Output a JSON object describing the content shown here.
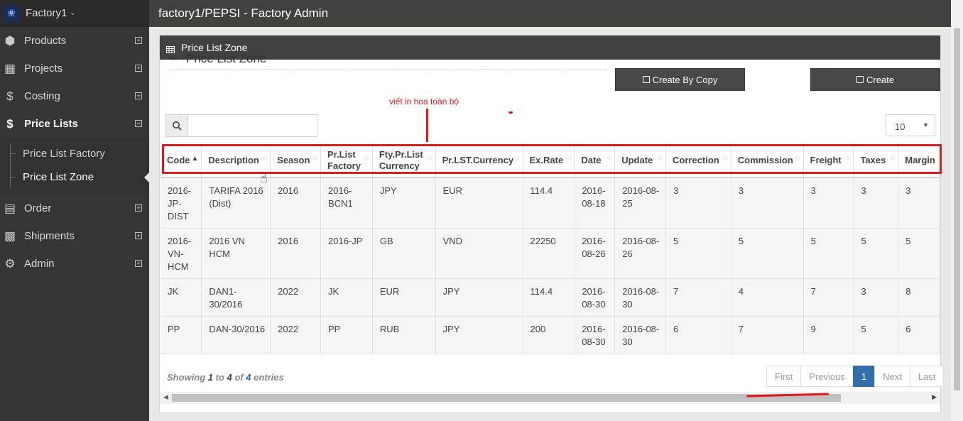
{
  "brand": {
    "name": "Factory1"
  },
  "header": {
    "title": "factory1/PEPSI - Factory Admin"
  },
  "sidebar": {
    "items": [
      {
        "label": "Products"
      },
      {
        "label": "Projects"
      },
      {
        "label": "Costing"
      },
      {
        "label": "Price Lists"
      },
      {
        "label": "Order"
      },
      {
        "label": "Shipments"
      },
      {
        "label": "Admin"
      }
    ],
    "submenu": [
      {
        "label": "Price List Factory"
      },
      {
        "label": "Price List Zone"
      }
    ]
  },
  "panel": {
    "heading": "Price List Zone",
    "subtitle": "Price List Zone",
    "create_by_copy_label": "Create By Copy",
    "create_label": "Create",
    "annotation": "viết in hoa toàn bộ",
    "page_length": "10"
  },
  "table": {
    "columns": [
      "Code",
      "Description",
      "Season",
      "Pr.List Factory",
      "Fty.Pr.List Currency",
      "Pr.LST.Currency",
      "Ex.Rate",
      "Date",
      "Update",
      "Correction",
      "Commission",
      "Freight",
      "Taxes",
      "Margin"
    ],
    "rows": [
      [
        "2016-JP-DIST",
        "TARIFA 2016 (Dist)",
        "2016",
        "2016-BCN1",
        "JPY",
        "EUR",
        "114.4",
        "2016-08-18",
        "2016-08-25",
        "3",
        "3",
        "3",
        "3",
        "3"
      ],
      [
        "2016-VN-HCM",
        "2016 VN HCM",
        "2016",
        "2016-JP",
        "GB",
        "VND",
        "22250",
        "2016-08-26",
        "2016-08-26",
        "5",
        "5",
        "5",
        "5",
        "5"
      ],
      [
        "JK",
        "DAN1-30/2016",
        "2022",
        "JK",
        "EUR",
        "JPY",
        "114.4",
        "2016-08-30",
        "2016-08-30",
        "7",
        "4",
        "7",
        "3",
        "8"
      ],
      [
        "PP",
        "DAN-30/2016",
        "2022",
        "PP",
        "RUB",
        "JPY",
        "200",
        "2016-08-30",
        "2016-08-30",
        "6",
        "7",
        "9",
        "5",
        "6"
      ]
    ]
  },
  "footer": {
    "info_prefix": "Showing ",
    "info_from": "1",
    "info_to_word": " to ",
    "info_to": "4",
    "info_of_word": " of ",
    "info_total": "4",
    "info_suffix": " entries",
    "pager": {
      "first": "First",
      "previous": "Previous",
      "current": "1",
      "next": "Next",
      "last": "Last"
    }
  },
  "colors": {
    "sidebar": "#383633",
    "header": "#43413e",
    "annotation": "#e0191c",
    "page_active": "#2f6fab"
  }
}
